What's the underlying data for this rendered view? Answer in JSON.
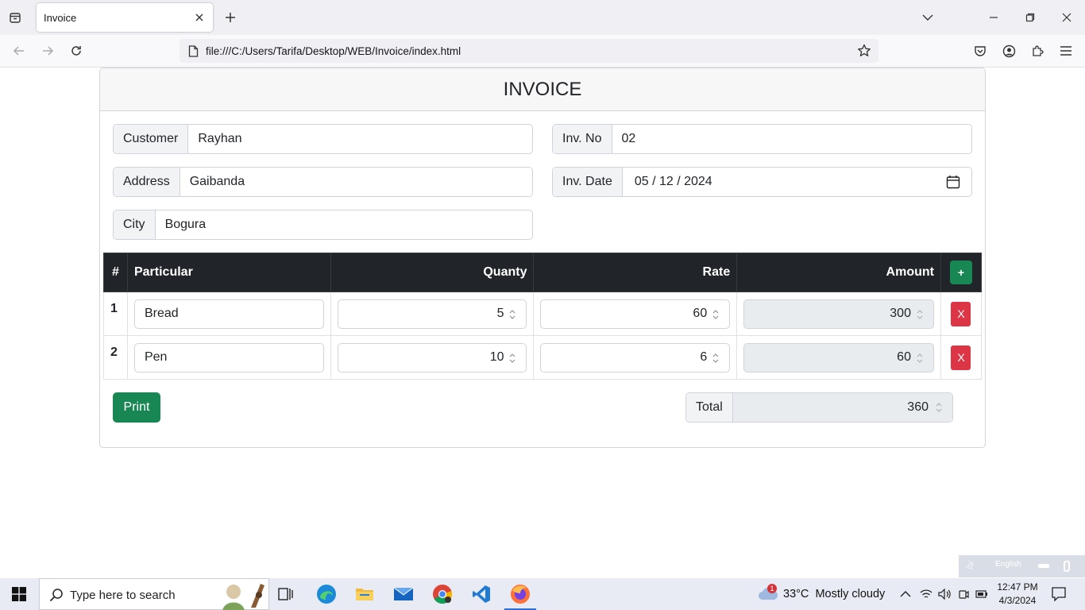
{
  "browser": {
    "tab_title": "Invoice",
    "url": "file:///C:/Users/Tarifa/Desktop/WEB/Invoice/index.html"
  },
  "invoice": {
    "title": "INVOICE",
    "customer": {
      "label": "Customer",
      "value": "Rayhan"
    },
    "address": {
      "label": "Address",
      "value": "Gaibanda"
    },
    "city": {
      "label": "City",
      "value": "Bogura"
    },
    "inv_no": {
      "label": "Inv. No",
      "value": "02"
    },
    "inv_date": {
      "label": "Inv. Date",
      "value": "05 / 12 / 2024"
    },
    "table": {
      "headers": {
        "num": "#",
        "particular": "Particular",
        "quantity": "Quanty",
        "rate": "Rate",
        "amount": "Amount",
        "add": "+"
      },
      "rows": [
        {
          "num": "1",
          "particular": "Bread",
          "quantity": "5",
          "rate": "60",
          "amount": "300",
          "remove": "X"
        },
        {
          "num": "2",
          "particular": "Pen",
          "quantity": "10",
          "rate": "6",
          "amount": "60",
          "remove": "X"
        }
      ]
    },
    "print_label": "Print",
    "total": {
      "label": "Total",
      "value": "360"
    }
  },
  "langbar": {
    "label": "English"
  },
  "taskbar": {
    "search_placeholder": "Type here to search",
    "weather": "33°C  Mostly cloudy",
    "weather_badge": "1",
    "time": "12:47 PM",
    "date": "4/3/2024"
  },
  "colors": {
    "table_header": "#212529",
    "btn_success": "#198754",
    "btn_danger": "#dc3545"
  }
}
